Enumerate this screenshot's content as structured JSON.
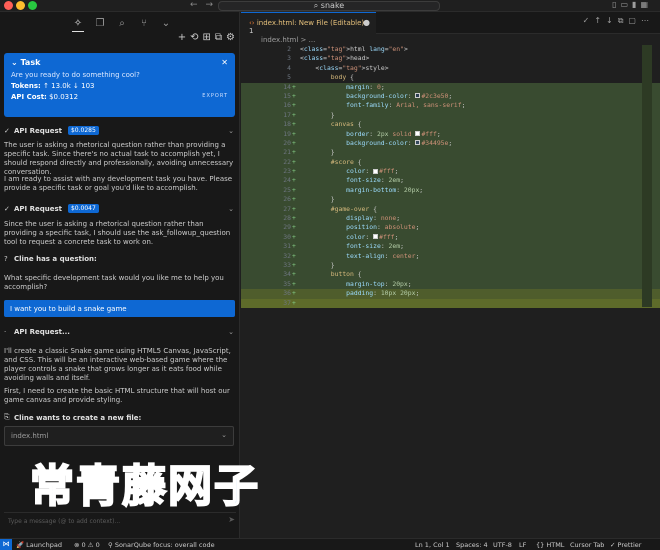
{
  "titlebar": {
    "search": "snake",
    "traffic_colors": [
      "#ff5f57",
      "#febc2e",
      "#28c840"
    ]
  },
  "sidebar": {
    "tabs": [
      "cline-icon",
      "files-icon",
      "search-icon",
      "git-icon",
      "chevron-down-icon"
    ],
    "actions": [
      "+",
      "⟲",
      "⊞",
      "⧉",
      "⚙"
    ]
  },
  "task": {
    "header": "Task",
    "question": "Are you ready to do something cool?",
    "tokens_label": "Tokens:",
    "tokens_up": "↑ 13.0k",
    "tokens_down": "↓ 103",
    "cost_label": "API Cost:",
    "cost_value": "$0.0312",
    "export_label": "EXPORT"
  },
  "chat": {
    "req1_title": "API Request",
    "req1_badge": "$0.0285",
    "req1_text": "The user is asking a rhetorical question rather than providing a specific task. Since there's no actual task to accomplish yet, I should respond directly and professionally, avoiding unnecessary conversation.",
    "reply1": "I am ready to assist with any development task you have. Please provide a specific task or goal you'd like to accomplish.",
    "req2_title": "API Request",
    "req2_badge": "$0.0047",
    "req2_text": "Since the user is asking a rhetorical question rather than providing a specific task, I should use the ask_followup_question tool to request a concrete task to work on.",
    "question_title": "Cline has a question:",
    "question_text": "What specific development task would you like me to help you accomplish?",
    "user_reply": "I want you to build a snake game",
    "req3_title": "API Request...",
    "req3_text": "I'll create a classic Snake game using HTML5 Canvas, JavaScript, and CSS. This will be an interactive web-based game where the player controls a snake that grows longer as it eats food while avoiding walls and itself.",
    "req3_text2": "First, I need to create the basic HTML structure that will host our game canvas and provide styling.",
    "file_title": "Cline wants to create a new file:",
    "file_name": "index.html",
    "input_placeholder": "Type a message (@ to add context)..."
  },
  "editor": {
    "tab_label": "index.html: New File (Editable)",
    "tab_count": "1",
    "breadcrumb": "index.html > ...",
    "lines": [
      {
        "n": "2",
        "t": "<html lang=\"en\">",
        "added": false
      },
      {
        "n": "3",
        "t": "<head>",
        "added": false
      },
      {
        "n": "4",
        "t": "    <style>",
        "added": false
      },
      {
        "n": "5",
        "t": "        body {",
        "added": false
      },
      {
        "n": "14",
        "t": "            margin: 0;",
        "added": true
      },
      {
        "n": "15",
        "t": "            background-color: #2c3e50;",
        "added": true
      },
      {
        "n": "16",
        "t": "            font-family: Arial, sans-serif;",
        "added": true
      },
      {
        "n": "17",
        "t": "        }",
        "added": true
      },
      {
        "n": "18",
        "t": "        canvas {",
        "added": true
      },
      {
        "n": "19",
        "t": "            border: 2px solid #fff;",
        "added": true
      },
      {
        "n": "20",
        "t": "            background-color: #34495e;",
        "added": true
      },
      {
        "n": "21",
        "t": "        }",
        "added": true
      },
      {
        "n": "22",
        "t": "        #score {",
        "added": true
      },
      {
        "n": "23",
        "t": "            color: #fff;",
        "added": true
      },
      {
        "n": "24",
        "t": "            font-size: 2em;",
        "added": true
      },
      {
        "n": "25",
        "t": "            margin-bottom: 20px;",
        "added": true
      },
      {
        "n": "26",
        "t": "        }",
        "added": true
      },
      {
        "n": "27",
        "t": "        #game-over {",
        "added": true
      },
      {
        "n": "28",
        "t": "            display: none;",
        "added": true
      },
      {
        "n": "29",
        "t": "            position: absolute;",
        "added": true
      },
      {
        "n": "30",
        "t": "            color: #fff;",
        "added": true
      },
      {
        "n": "31",
        "t": "            font-size: 2em;",
        "added": true
      },
      {
        "n": "32",
        "t": "            text-align: center;",
        "added": true
      },
      {
        "n": "33",
        "t": "        }",
        "added": true
      },
      {
        "n": "34",
        "t": "        button {",
        "added": true
      },
      {
        "n": "35",
        "t": "            margin-top: 20px;",
        "added": true
      },
      {
        "n": "36",
        "t": "            padding: 10px 20px;",
        "added": true
      },
      {
        "n": "37",
        "t": "",
        "added": true
      }
    ]
  },
  "status": {
    "launchpad": "Launchpad",
    "errors": "⊗ 0 ⚠ 0",
    "sonar": "SonarQube focus: overall code",
    "position": "Ln 1, Col 1",
    "spaces": "Spaces: 4",
    "encoding": "UTF-8",
    "eol": "LF",
    "language": "HTML",
    "cursor": "Cursor Tab",
    "prettier": "✓ Prettier"
  },
  "watermark": "常青藤网子",
  "colors": {
    "accent": "#0e68d3",
    "added_bg": "#394b30"
  }
}
